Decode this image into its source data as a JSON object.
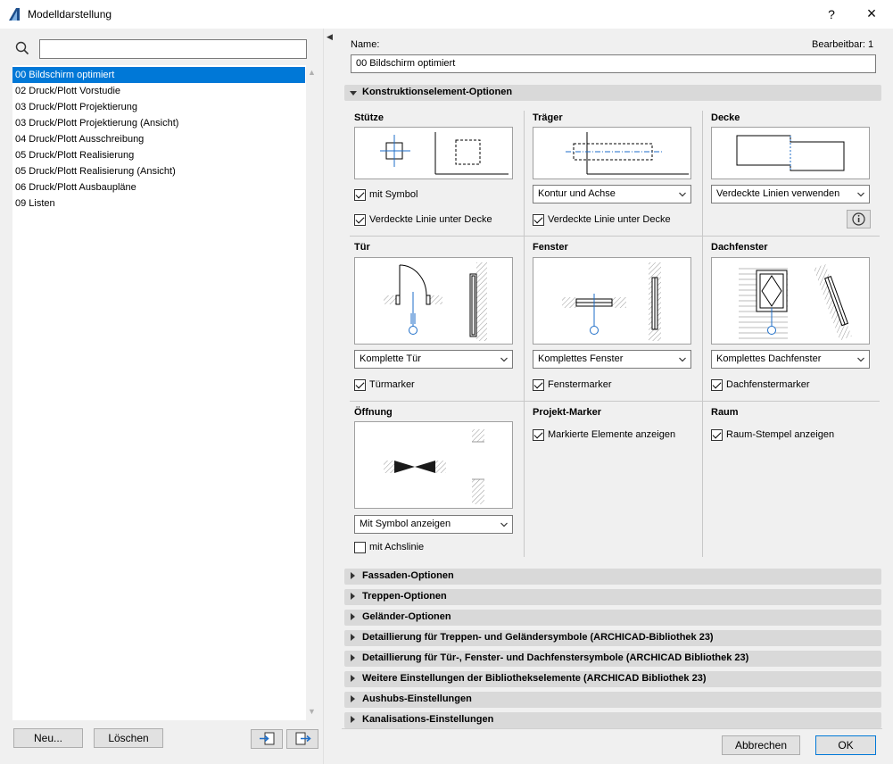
{
  "window": {
    "title": "Modelldarstellung",
    "help": "?",
    "close": "×"
  },
  "sidebar": {
    "search_placeholder": "",
    "items": [
      "00 Bildschirm optimiert",
      "02 Druck/Plott Vorstudie",
      "03 Druck/Plott Projektierung",
      "03 Druck/Plott Projektierung (Ansicht)",
      "04 Druck/Plott Ausschreibung",
      "05 Druck/Plott Realisierung",
      "05 Druck/Plott Realisierung (Ansicht)",
      "06 Druck/Plott Ausbaupläne",
      "09 Listen"
    ],
    "selected_index": 0,
    "new_label": "Neu...",
    "delete_label": "Löschen"
  },
  "main": {
    "name_label": "Name:",
    "name_value": "00 Bildschirm optimiert",
    "editable_label": "Bearbeitbar: 1",
    "construction_header": "Konstruktionselement-Optionen",
    "stuetze": {
      "title": "Stütze",
      "check1": "mit Symbol",
      "check1_on": true,
      "check2": "Verdeckte Linie unter Decke",
      "check2_on": true
    },
    "traeger": {
      "title": "Träger",
      "dropdown": "Kontur und Achse",
      "check": "Verdeckte Linie unter Decke",
      "check_on": true
    },
    "decke": {
      "title": "Decke",
      "dropdown": "Verdeckte Linien verwenden"
    },
    "tuer": {
      "title": "Tür",
      "dropdown": "Komplette Tür",
      "check": "Türmarker",
      "check_on": true
    },
    "fenster": {
      "title": "Fenster",
      "dropdown": "Komplettes Fenster",
      "check": "Fenstermarker",
      "check_on": true
    },
    "dachfenster": {
      "title": "Dachfenster",
      "dropdown": "Komplettes Dachfenster",
      "check": "Dachfenstermarker",
      "check_on": true
    },
    "oeffnung": {
      "title": "Öffnung",
      "dropdown": "Mit Symbol anzeigen",
      "check": "mit Achslinie",
      "check_on": false
    },
    "projekt_marker": {
      "title": "Projekt-Marker",
      "check": "Markierte Elemente anzeigen",
      "check_on": true
    },
    "raum": {
      "title": "Raum",
      "check": "Raum-Stempel anzeigen",
      "check_on": true
    },
    "collapsed_sections": [
      "Fassaden-Optionen",
      "Treppen-Optionen",
      "Geländer-Optionen",
      "Detaillierung für Treppen- und Geländersymbole (ARCHICAD-Bibliothek 23)",
      "Detaillierung für Tür-, Fenster- und Dachfenstersymbole (ARCHICAD Bibliothek 23)",
      "Weitere Einstellungen der Bibliothekselemente (ARCHICAD Bibliothek 23)",
      "Aushubs-Einstellungen",
      "Kanalisations-Einstellungen"
    ]
  },
  "footer": {
    "cancel_label": "Abbrechen",
    "ok_label": "OK"
  },
  "colors": {
    "accent": "#0078d7",
    "section_header": "#d9d9d9",
    "panel": "#f0f0f0"
  }
}
